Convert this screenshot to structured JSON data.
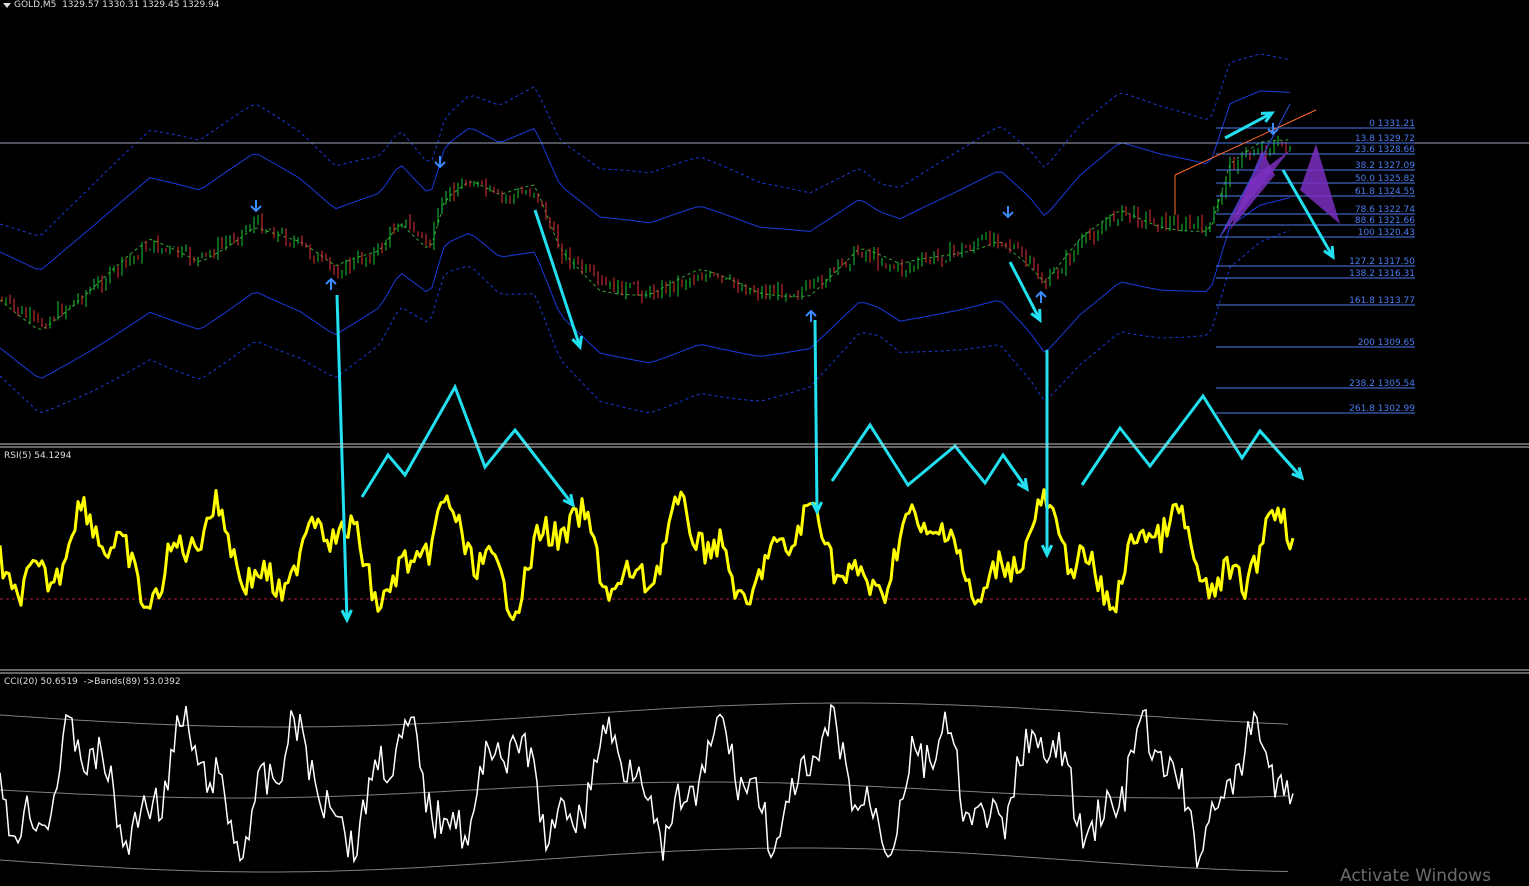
{
  "window": {
    "symbol_header": "GOLD,M5  1329.57 1330.31 1329.45 1329.94"
  },
  "indicators": {
    "rsi_label": "RSI(5) 54.1294",
    "cci_label": "CCI(20) 50.6519  ->Bands(89) 53.0392"
  },
  "fibonacci_levels": [
    {
      "ratio": "0",
      "price": "1331.21"
    },
    {
      "ratio": "13.8",
      "price": "1329.72"
    },
    {
      "ratio": "23.6",
      "price": "1328.66"
    },
    {
      "ratio": "38.2",
      "price": "1327.09"
    },
    {
      "ratio": "50.0",
      "price": "1325.82"
    },
    {
      "ratio": "61.8",
      "price": "1324.55"
    },
    {
      "ratio": "78.6",
      "price": "1322.74"
    },
    {
      "ratio": "88.6",
      "price": "1321.66"
    },
    {
      "ratio": "100",
      "price": "1320.43"
    },
    {
      "ratio": "127.2",
      "price": "1317.50"
    },
    {
      "ratio": "138.2",
      "price": "1316.31"
    },
    {
      "ratio": "161.8",
      "price": "1313.77"
    },
    {
      "ratio": "200",
      "price": "1309.65"
    },
    {
      "ratio": "238.2",
      "price": "1305.54"
    },
    {
      "ratio": "261.8",
      "price": "1302.99"
    }
  ],
  "watermark": "Activate Windows",
  "colors": {
    "background": "#000000",
    "bull_candle": "#19c93a",
    "bear_candle": "#e63232",
    "fib": "#4c7cf0",
    "rsi_line": "#ffff00",
    "cci_line": "#ffffff",
    "annotation_arrows": "#22e0f0",
    "pattern_fill": "#7a2fc0",
    "bands": "#1a3ad8",
    "signal_arrows": "#3a8cff"
  },
  "icons": {
    "buy_arrow": "arrow-up-icon",
    "sell_arrow": "arrow-down-icon",
    "menu": "triangle-down-icon"
  }
}
